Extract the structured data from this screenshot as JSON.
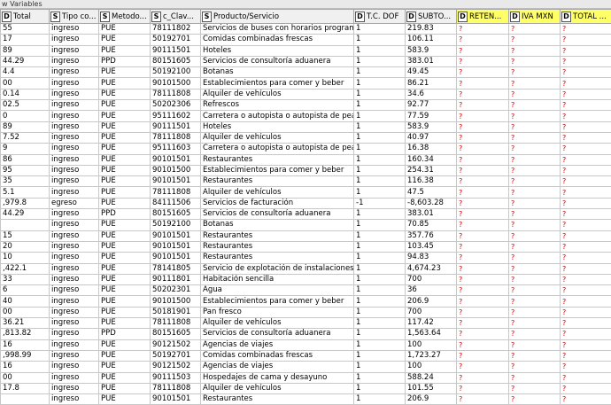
{
  "panel": {
    "title": "w Variables"
  },
  "columns": [
    {
      "type": "D",
      "label": "Total",
      "highlight": false
    },
    {
      "type": "S",
      "label": "Tipo co...",
      "highlight": false
    },
    {
      "type": "S",
      "label": "Metodo...",
      "highlight": false
    },
    {
      "type": "S",
      "label": "c_Clav...",
      "highlight": false
    },
    {
      "type": "S",
      "label": "Producto/Servicio",
      "highlight": false
    },
    {
      "type": "D",
      "label": "T.C. DOF",
      "highlight": false
    },
    {
      "type": "D",
      "label": "SUBTO...",
      "highlight": false
    },
    {
      "type": "D",
      "label": "RETEN...",
      "highlight": true
    },
    {
      "type": "D",
      "label": "IVA MXN",
      "highlight": true
    },
    {
      "type": "D",
      "label": "TOTAL ...",
      "highlight": true
    }
  ],
  "missing_marker": "?",
  "rows": [
    [
      "55",
      "ingreso",
      "PUE",
      "78111802",
      "Servicios de buses con horarios programados",
      "1",
      "219.83"
    ],
    [
      "17",
      "ingreso",
      "PUE",
      "50192701",
      "Comidas combinadas frescas",
      "1",
      "106.11"
    ],
    [
      "89",
      "ingreso",
      "PUE",
      "90111501",
      "Hoteles",
      "1",
      "583.9"
    ],
    [
      "44.29",
      "ingreso",
      "PPD",
      "80151605",
      "Servicios de consultoría aduanera",
      "1",
      "383.01"
    ],
    [
      "4.4",
      "ingreso",
      "PUE",
      "50192100",
      "Botanas",
      "1",
      "49.45"
    ],
    [
      "00",
      "ingreso",
      "PUE",
      "90101500",
      "Establecimientos para comer y beber",
      "1",
      "86.21"
    ],
    [
      "0.14",
      "ingreso",
      "PUE",
      "78111808",
      "Alquiler de vehículos",
      "1",
      "34.6"
    ],
    [
      "02.5",
      "ingreso",
      "PUE",
      "50202306",
      "Refrescos",
      "1",
      "92.77"
    ],
    [
      "0",
      "ingreso",
      "PUE",
      "95111602",
      "Carretera o autopista  o autopista de peaj...",
      "1",
      "77.59"
    ],
    [
      "89",
      "ingreso",
      "PUE",
      "90111501",
      "Hoteles",
      "1",
      "583.9"
    ],
    [
      "7.52",
      "ingreso",
      "PUE",
      "78111808",
      "Alquiler de vehículos",
      "1",
      "40.97"
    ],
    [
      "9",
      "ingreso",
      "PUE",
      "95111603",
      "Carretera o autopista  o autopista de peaj...",
      "1",
      "16.38"
    ],
    [
      "86",
      "ingreso",
      "PUE",
      "90101501",
      "Restaurantes",
      "1",
      "160.34"
    ],
    [
      "95",
      "ingreso",
      "PUE",
      "90101500",
      "Establecimientos para comer y beber",
      "1",
      "254.31"
    ],
    [
      "35",
      "ingreso",
      "PUE",
      "90101501",
      "Restaurantes",
      "1",
      "116.38"
    ],
    [
      "5.1",
      "ingreso",
      "PUE",
      "78111808",
      "Alquiler de vehículos",
      "1",
      "47.5"
    ],
    [
      ",979.8",
      "egreso",
      "PUE",
      "84111506",
      "Servicios de facturación",
      "-1",
      "-8,603.28"
    ],
    [
      "44.29",
      "ingreso",
      "PPD",
      "80151605",
      "Servicios de consultoría aduanera",
      "1",
      "383.01"
    ],
    [
      "",
      "ingreso",
      "PUE",
      "50192100",
      "Botanas",
      "1",
      "70.85"
    ],
    [
      "15",
      "ingreso",
      "PUE",
      "90101501",
      "Restaurantes",
      "1",
      "357.76"
    ],
    [
      "20",
      "ingreso",
      "PUE",
      "90101501",
      "Restaurantes",
      "1",
      "103.45"
    ],
    [
      "10",
      "ingreso",
      "PUE",
      "90101501",
      "Restaurantes",
      "1",
      "94.83"
    ],
    [
      ",422.1",
      "ingreso",
      "PUE",
      "78141805",
      "Servicio de explotación de instalaciones de ...",
      "1",
      "4,674.23"
    ],
    [
      "33",
      "ingreso",
      "PUE",
      "90111801",
      "Habitación sencilla",
      "1",
      "700"
    ],
    [
      "6",
      "ingreso",
      "PUE",
      "50202301",
      "Agua",
      "1",
      "36"
    ],
    [
      "40",
      "ingreso",
      "PUE",
      "90101500",
      "Establecimientos para comer y beber",
      "1",
      "206.9"
    ],
    [
      "00",
      "ingreso",
      "PUE",
      "50181901",
      "Pan fresco",
      "1",
      "700"
    ],
    [
      "36.21",
      "ingreso",
      "PUE",
      "78111808",
      "Alquiler de vehículos",
      "1",
      "117.42"
    ],
    [
      ",813.82",
      "ingreso",
      "PPD",
      "80151605",
      "Servicios de consultoría aduanera",
      "1",
      "1,563.64"
    ],
    [
      "16",
      "ingreso",
      "PUE",
      "90121502",
      "Agencias de viajes",
      "1",
      "100"
    ],
    [
      ",998.99",
      "ingreso",
      "PUE",
      "50192701",
      "Comidas combinadas frescas",
      "1",
      "1,723.27"
    ],
    [
      "16",
      "ingreso",
      "PUE",
      "90121502",
      "Agencias de viajes",
      "1",
      "100"
    ],
    [
      "00",
      "ingreso",
      "PUE",
      "90111503",
      "Hospedajes de cama y desayuno",
      "1",
      "588.24"
    ],
    [
      "17.8",
      "ingreso",
      "PUE",
      "78111808",
      "Alquiler de vehículos",
      "1",
      "101.55"
    ],
    [
      "",
      "ingreso",
      "PUE",
      "90101501",
      "Restaurantes",
      "1",
      "206.9"
    ]
  ]
}
